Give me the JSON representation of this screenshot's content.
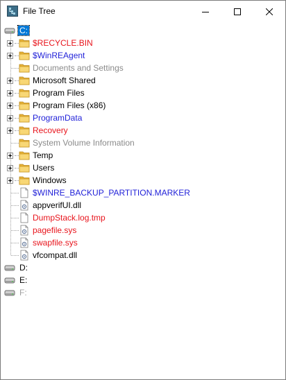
{
  "window": {
    "title": "File Tree",
    "controls": {
      "minimize": "minimize",
      "maximize": "maximize",
      "close": "close"
    }
  },
  "tree": {
    "drives": [
      {
        "label": "C:",
        "selected": true,
        "expanded": true
      },
      {
        "label": "D:",
        "color": "#000000"
      },
      {
        "label": "E:",
        "color": "#000000"
      },
      {
        "label": "F:",
        "color": "#a0a0a0"
      }
    ],
    "c_children": [
      {
        "label": "$RECYCLE.BIN",
        "type": "folder",
        "expandable": true,
        "color": "#e8141c"
      },
      {
        "label": "$WinREAgent",
        "type": "folder",
        "expandable": true,
        "color": "#1f1fd8"
      },
      {
        "label": "Documents and Settings",
        "type": "folder",
        "expandable": false,
        "color": "#8a8a8a"
      },
      {
        "label": "Microsoft Shared",
        "type": "folder",
        "expandable": true,
        "color": "#000000"
      },
      {
        "label": "Program Files",
        "type": "folder",
        "expandable": true,
        "color": "#000000"
      },
      {
        "label": "Program Files (x86)",
        "type": "folder",
        "expandable": true,
        "color": "#000000"
      },
      {
        "label": "ProgramData",
        "type": "folder",
        "expandable": true,
        "color": "#1f1fd8"
      },
      {
        "label": "Recovery",
        "type": "folder",
        "expandable": true,
        "color": "#e8141c"
      },
      {
        "label": "System Volume Information",
        "type": "folder",
        "expandable": false,
        "color": "#8a8a8a"
      },
      {
        "label": "Temp",
        "type": "folder",
        "expandable": true,
        "color": "#000000"
      },
      {
        "label": "Users",
        "type": "folder",
        "expandable": true,
        "color": "#000000"
      },
      {
        "label": "Windows",
        "type": "folder",
        "expandable": true,
        "color": "#000000"
      },
      {
        "label": "$WINRE_BACKUP_PARTITION.MARKER",
        "type": "file",
        "color": "#1f1fd8"
      },
      {
        "label": "appverifUI.dll",
        "type": "dll",
        "color": "#000000"
      },
      {
        "label": "DumpStack.log.tmp",
        "type": "file",
        "color": "#e8141c"
      },
      {
        "label": "pagefile.sys",
        "type": "dll",
        "color": "#e8141c"
      },
      {
        "label": "swapfile.sys",
        "type": "dll",
        "color": "#e8141c"
      },
      {
        "label": "vfcompat.dll",
        "type": "dll",
        "color": "#000000"
      }
    ]
  },
  "icons": {
    "app": "file-tree-app-icon",
    "drive": "hard-drive-icon",
    "folder": "folder-icon",
    "file": "document-icon",
    "dll": "settings-file-icon"
  }
}
